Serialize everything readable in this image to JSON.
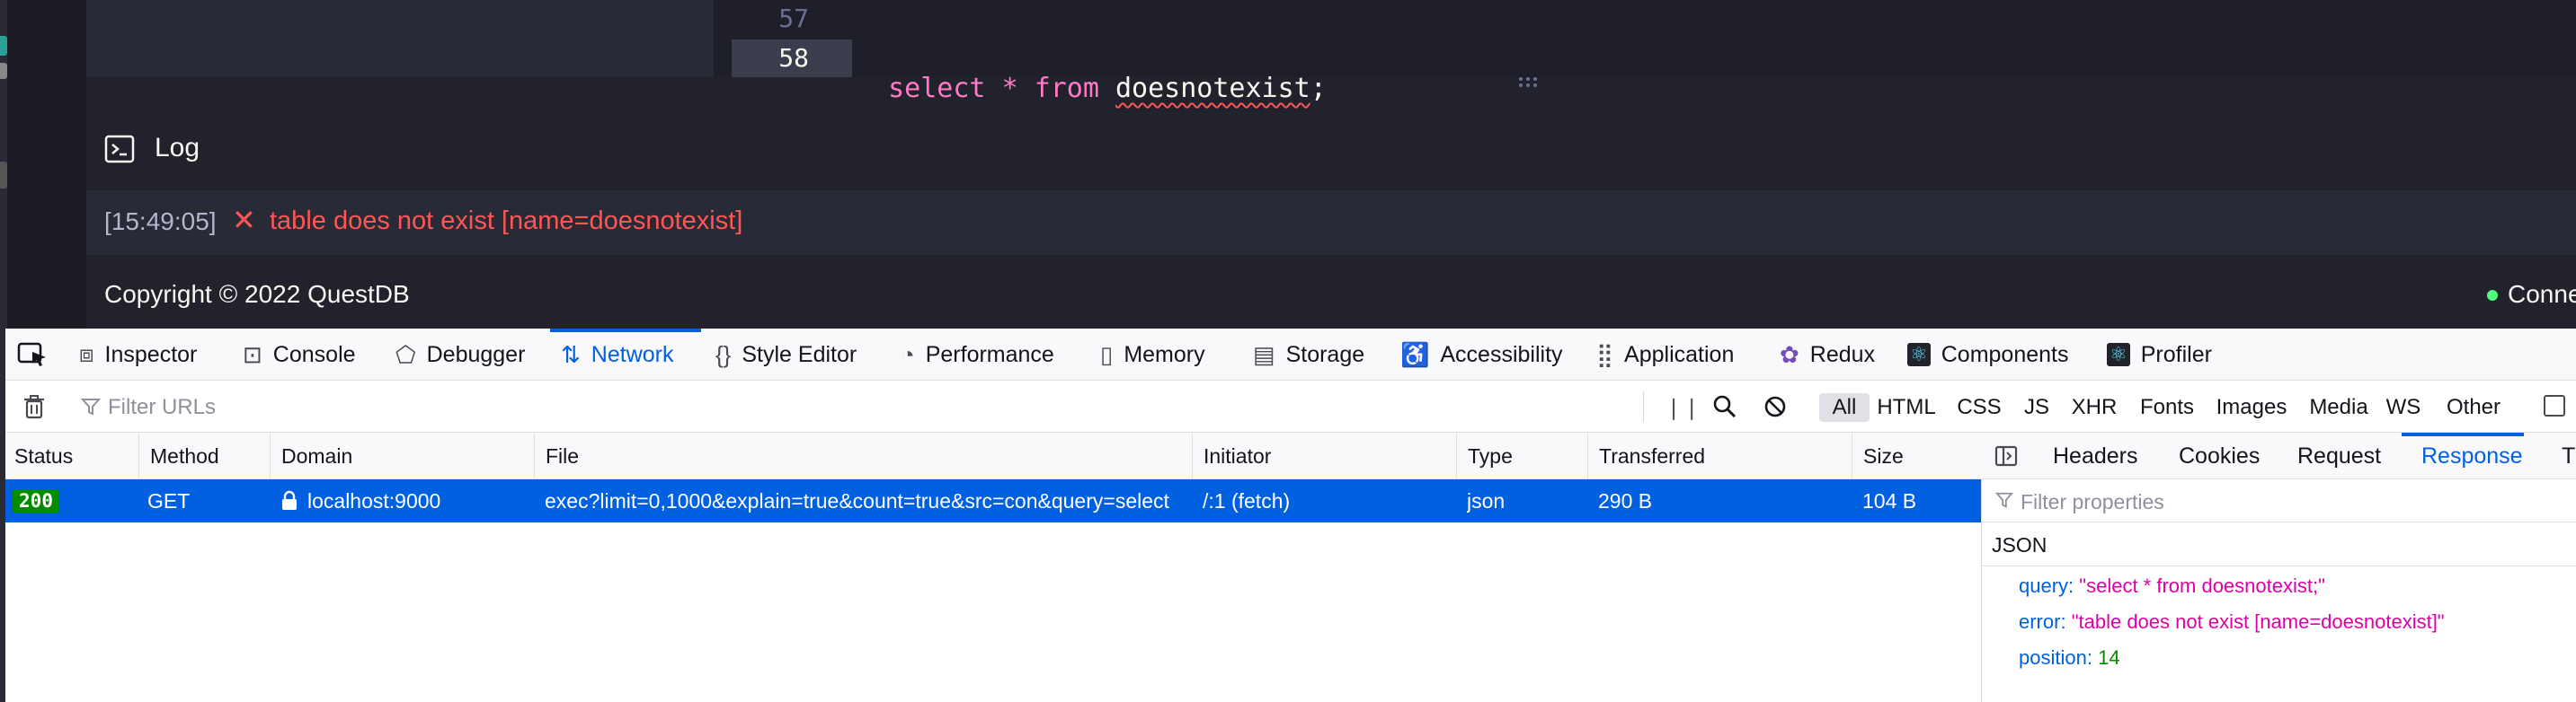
{
  "editor": {
    "lines": [
      {
        "number": "57",
        "tokens": []
      },
      {
        "number": "58",
        "tokens": [
          {
            "text": "select",
            "kind": "keyword"
          },
          {
            "text": " ",
            "kind": "space"
          },
          {
            "text": "*",
            "kind": "operator"
          },
          {
            "text": " ",
            "kind": "space"
          },
          {
            "text": "from",
            "kind": "keyword"
          },
          {
            "text": " ",
            "kind": "space"
          },
          {
            "text": "doesnotexist",
            "kind": "identifier-error"
          },
          {
            "text": ";",
            "kind": "punct"
          }
        ]
      }
    ]
  },
  "log": {
    "title": "Log",
    "entries": [
      {
        "time": "[15:49:05]",
        "status_icon": "✕",
        "message": "table does not exist [name=doesnotexist]"
      }
    ]
  },
  "footer": {
    "copyright": "Copyright © 2022 QuestDB",
    "connection_status": "Conne"
  },
  "devtools": {
    "tabs": [
      {
        "label": "Inspector",
        "icon": "inspector-icon"
      },
      {
        "label": "Console",
        "icon": "console-icon"
      },
      {
        "label": "Debugger",
        "icon": "debugger-icon"
      },
      {
        "label": "Network",
        "icon": "network-icon",
        "active": true
      },
      {
        "label": "Style Editor",
        "icon": "style-editor-icon"
      },
      {
        "label": "Performance",
        "icon": "performance-icon"
      },
      {
        "label": "Memory",
        "icon": "memory-icon"
      },
      {
        "label": "Storage",
        "icon": "storage-icon"
      },
      {
        "label": "Accessibility",
        "icon": "accessibility-icon"
      },
      {
        "label": "Application",
        "icon": "application-icon"
      },
      {
        "label": "Redux",
        "icon": "redux-icon"
      },
      {
        "label": "Components",
        "icon": "react-icon"
      },
      {
        "label": "Profiler",
        "icon": "react-icon"
      }
    ],
    "filter": {
      "placeholder": "Filter URLs",
      "type_filters": [
        "All",
        "HTML",
        "CSS",
        "JS",
        "XHR",
        "Fonts",
        "Images",
        "Media",
        "WS",
        "Other"
      ],
      "selected_type": "All"
    },
    "table": {
      "columns": [
        "Status",
        "Method",
        "Domain",
        "File",
        "Initiator",
        "Type",
        "Transferred",
        "Size"
      ],
      "rows": [
        {
          "status": "200",
          "method": "GET",
          "domain": "localhost:9000",
          "file": "exec?limit=0,1000&explain=true&count=true&src=con&query=select",
          "initiator": "/:1 (fetch)",
          "type": "json",
          "transferred": "290 B",
          "size": "104 B"
        }
      ]
    },
    "details": {
      "tabs": [
        "Headers",
        "Cookies",
        "Request",
        "Response",
        "Ti"
      ],
      "active_tab": "Response",
      "filter_placeholder": "Filter properties",
      "section_label": "JSON",
      "properties": [
        {
          "key": "query:",
          "value": "\"select * from doesnotexist;\"",
          "kind": "string"
        },
        {
          "key": "error:",
          "value": "\"table does not exist [name=doesnotexist]\"",
          "kind": "string"
        },
        {
          "key": "position:",
          "value": "14",
          "kind": "number"
        }
      ]
    }
  },
  "colors": {
    "accent": "#0060df",
    "error": "#ff5555",
    "keyword": "#ff79c6",
    "status_ok": "#058b00",
    "connected": "#50fa7b"
  }
}
